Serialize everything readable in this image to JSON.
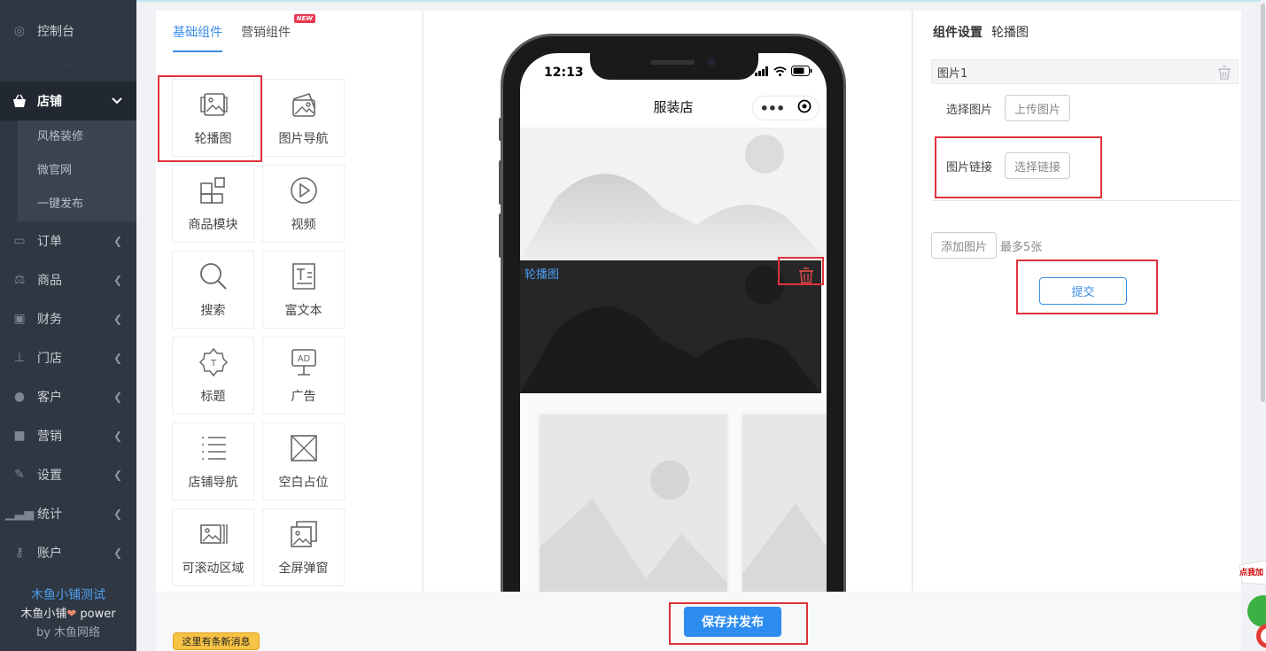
{
  "sidebar": {
    "items": [
      {
        "label": "控制台",
        "icon": "dashboard-icon"
      },
      {
        "label": "店铺",
        "icon": "store-icon",
        "active": true
      },
      {
        "label": "订单",
        "icon": "order-icon"
      },
      {
        "label": "商品",
        "icon": "scale-icon"
      },
      {
        "label": "财务",
        "icon": "money-icon"
      },
      {
        "label": "门店",
        "icon": "branch-icon"
      },
      {
        "label": "客户",
        "icon": "users-icon"
      },
      {
        "label": "营销",
        "icon": "gift-icon"
      },
      {
        "label": "设置",
        "icon": "wrench-icon"
      },
      {
        "label": "统计",
        "icon": "bar-chart-icon"
      },
      {
        "label": "账户",
        "icon": "key-icon"
      }
    ],
    "sub_items": [
      "风格装修",
      "微官网",
      "一键发布"
    ],
    "footer": {
      "brand": "木鱼小铺测试",
      "power_prefix": "木鱼小铺",
      "power_suffix": " power",
      "by": "by 木鱼网络"
    }
  },
  "components": {
    "tabs": [
      "基础组件",
      "营销组件"
    ],
    "new_badge": "NEW",
    "items": [
      {
        "label": "轮播图",
        "icon": "carousel-icon"
      },
      {
        "label": "图片导航",
        "icon": "image-nav-icon"
      },
      {
        "label": "商品模块",
        "icon": "product-module-icon"
      },
      {
        "label": "视频",
        "icon": "video-icon"
      },
      {
        "label": "搜索",
        "icon": "search-icon"
      },
      {
        "label": "富文本",
        "icon": "rich-text-icon"
      },
      {
        "label": "标题",
        "icon": "title-icon"
      },
      {
        "label": "广告",
        "icon": "ad-icon"
      },
      {
        "label": "店铺导航",
        "icon": "store-nav-icon"
      },
      {
        "label": "空白占位",
        "icon": "blank-placeholder-icon"
      },
      {
        "label": "可滚动区域",
        "icon": "scroll-area-icon"
      },
      {
        "label": "全屏弹窗",
        "icon": "fullscreen-popup-icon"
      }
    ]
  },
  "preview": {
    "status_time": "12:13",
    "title": "服装店",
    "selected_label": "轮播图"
  },
  "settings": {
    "header_bold": "组件设置",
    "header_name": "轮播图",
    "image_title": "图片1",
    "select_image_label": "选择图片",
    "upload_button": "上传图片",
    "link_label": "图片链接",
    "link_button": "选择链接",
    "add_button": "添加图片",
    "add_hint": "最多5张",
    "submit_button": "提交"
  },
  "bottom": {
    "publish_button": "保存并发布",
    "message_tag": "这里有条新消息"
  },
  "float_widget_text": "点我加"
}
